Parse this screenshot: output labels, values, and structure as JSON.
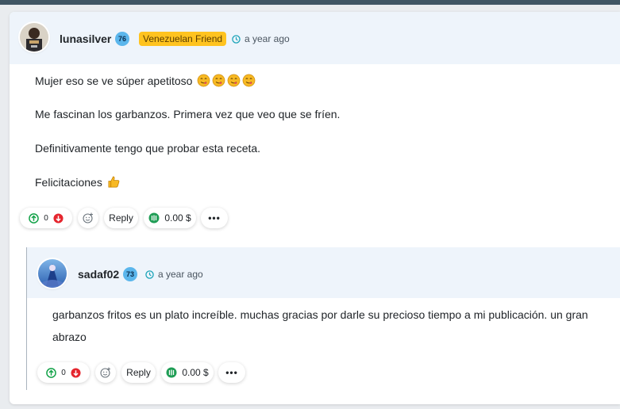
{
  "comment": {
    "username": "lunasilver",
    "reputation": "76",
    "badge": "Venezuelan Friend",
    "time": "a year ago",
    "paragraphs": [
      "Mujer eso se ve súper apetitoso",
      "Me fascinan los garbanzos. Primera vez que veo que se fríen.",
      "Definitivamente tengo que probar esta receta.",
      "Felicitaciones"
    ],
    "emoji_after_first": "yum-face x4",
    "emoji_after_last": "thumbs-up",
    "actions": {
      "upvote_count": "0",
      "reply_label": "Reply",
      "payout": "0.00 $",
      "more_label": "•••"
    }
  },
  "reply": {
    "username": "sadaf02",
    "reputation": "73",
    "time": "a year ago",
    "text_line1": "garbanzos fritos es un plato increíble. muchas gracias por darle su precioso tiempo a mi publicación. un gran",
    "text_line2": "abrazo",
    "actions": {
      "upvote_count": "0",
      "reply_label": "Reply",
      "payout": "0.00 $",
      "more_label": "•••"
    }
  },
  "colors": {
    "header_bg": "#eef4fb",
    "rep_badge": "#5bb6ec",
    "community_badge": "#ffc31f",
    "upvote_green": "#15a34a",
    "downvote_red": "#e5262e",
    "payout_green": "#1f9d55"
  }
}
